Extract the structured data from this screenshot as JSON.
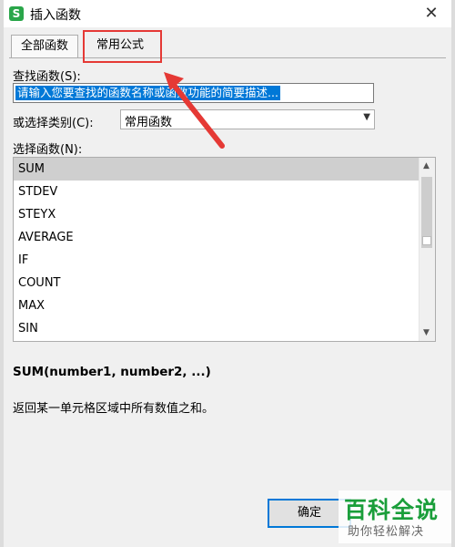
{
  "window": {
    "title": "插入函数",
    "app_icon_letter": "S",
    "close_symbol": "✕"
  },
  "tabs": [
    {
      "label": "全部函数",
      "active": true
    },
    {
      "label": "常用公式",
      "active": false,
      "highlighted": true
    }
  ],
  "search": {
    "label": "查找函数(S):",
    "value": "请输入您要查找的函数名称或函数功能的简要描述..."
  },
  "category": {
    "label": "或选择类别(C):",
    "value": "常用函数"
  },
  "function_list": {
    "label": "选择函数(N):",
    "items": [
      "SUM",
      "STDEV",
      "STEYX",
      "AVERAGE",
      "IF",
      "COUNT",
      "MAX",
      "SIN"
    ],
    "selected": "SUM"
  },
  "details": {
    "syntax": "SUM(number1, number2, ...)",
    "description": "返回某一单元格区域中所有数值之和。"
  },
  "buttons": {
    "ok": "确定"
  },
  "watermark": {
    "title": "百科全说",
    "subtitle": "助你轻松解决"
  },
  "colors": {
    "accent": "#0078d7",
    "annotation_red": "#e53935",
    "watermark_green": "#1a9e3a",
    "app_icon": "#2aa64a"
  }
}
